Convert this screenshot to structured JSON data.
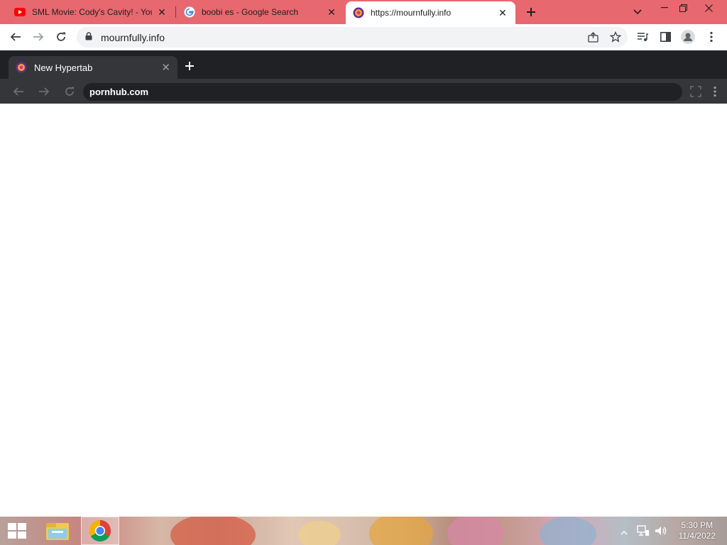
{
  "outer_browser": {
    "tabs": [
      {
        "title": "SML Movie: Cody's Cavity! - YouT",
        "favicon": "youtube-icon",
        "active": false
      },
      {
        "title": "boobi es - Google Search",
        "favicon": "google-icon",
        "active": false
      },
      {
        "title": "https://mournfully.info",
        "favicon": "hypertab-icon",
        "active": true
      }
    ],
    "address_bar": {
      "url": "mournfully.info"
    }
  },
  "inner_browser": {
    "tab": {
      "title": "New Hypertab",
      "favicon": "hypertab-icon"
    },
    "address_bar": {
      "url": "pornhub.com"
    }
  },
  "taskbar": {
    "pinned": [
      "windows-start-icon",
      "file-explorer-icon",
      "chrome-icon"
    ],
    "clock": {
      "time": "5:30 PM",
      "date": "11/4/2022"
    }
  },
  "colors": {
    "tab_strip": "#e8686f",
    "inner_chrome_dark": "#202124",
    "inner_toolbar": "#35363a"
  }
}
